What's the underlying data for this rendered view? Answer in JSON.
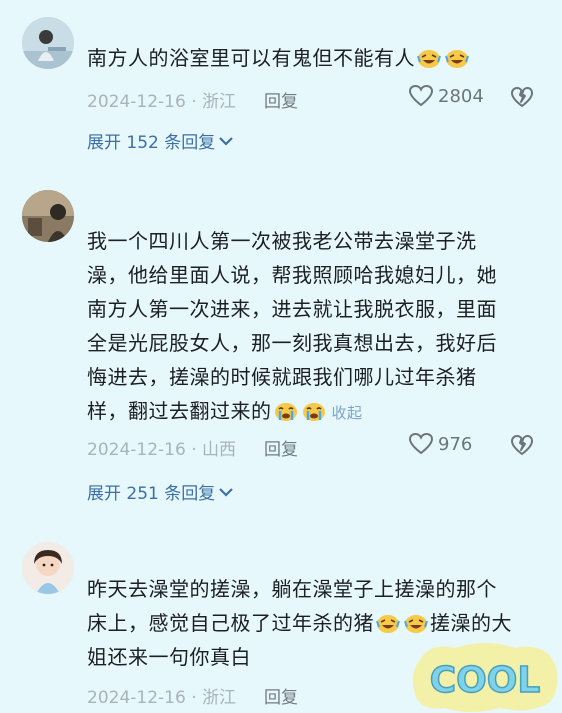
{
  "comments": [
    {
      "text": "南方人的浴室里可以有鬼但不能有人",
      "emoji_count": 2,
      "date_location": "2024-12-16 · 浙江",
      "reply_label": "回复",
      "likes": "2804",
      "expand_label": "展开 152 条回复"
    },
    {
      "lines": [
        "我一个四川人第一次被我老公带去澡堂子洗",
        "澡，他给里面人说，帮我照顾哈我媳妇儿，她",
        "南方人第一次进来，进去就让我脱衣服，里面",
        "全是光屁股女人，那一刻我真想出去，我好后",
        "悔进去，搓澡的时候就跟我们哪儿过年杀猪",
        "样，翻过去翻过来的"
      ],
      "collapse_label": "收起",
      "date_location": "2024-12-16 · 山西",
      "reply_label": "回复",
      "likes": "976",
      "expand_label": "展开 251 条回复"
    },
    {
      "lines": [
        "昨天去澡堂的搓澡，躺在澡堂子上搓澡的那个",
        "床上，感觉自己极了过年杀的猪",
        "姐还来一句你真白"
      ],
      "line2_tail": "搓澡的大",
      "date_location": "2024-12-16 · 浙江",
      "reply_label": "回复"
    }
  ],
  "sticker_text": "COOL",
  "colors": {
    "background": "#e6f8fb",
    "link": "#3c6fa4",
    "meta": "#a9b3ba"
  }
}
